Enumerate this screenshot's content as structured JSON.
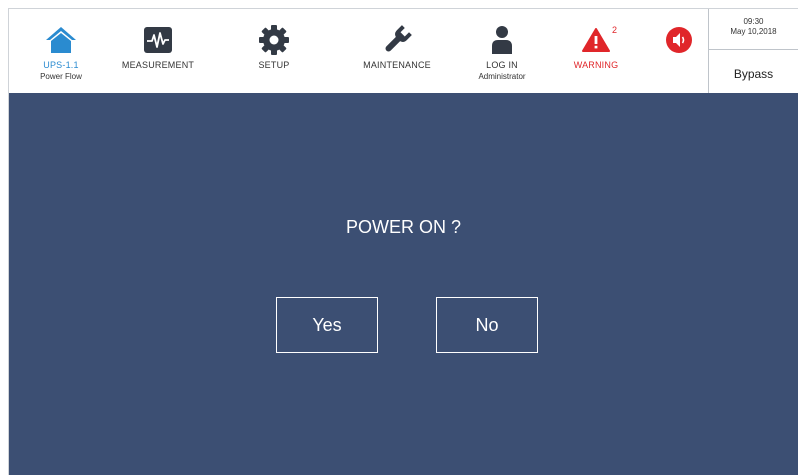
{
  "header": {
    "nav": [
      {
        "label": "UPS-1.1",
        "sub": "Power Flow",
        "icon": "home-icon",
        "color": "#2a8bd0"
      },
      {
        "label": "MEASUREMENT",
        "icon": "waveform-icon"
      },
      {
        "label": "SETUP",
        "icon": "gear-icon"
      },
      {
        "label": "MAINTENANCE",
        "icon": "wrench-icon"
      },
      {
        "label": "LOG IN",
        "sub": "Administrator",
        "icon": "user-icon"
      },
      {
        "label": "WARNING",
        "icon": "warning-icon",
        "badge": "2",
        "color": "#e0262a"
      },
      {
        "icon": "alarm-speaker-icon",
        "color": "#e0262a"
      }
    ],
    "time": "09:30",
    "date": "May 10,2018",
    "mode": "Bypass"
  },
  "dialog": {
    "title": "POWER ON ?",
    "yes_label": "Yes",
    "no_label": "No"
  },
  "colors": {
    "background": "#3c4f73",
    "accent_blue": "#2a8bd0",
    "alert_red": "#e0262a",
    "icon_dark": "#333a45"
  }
}
